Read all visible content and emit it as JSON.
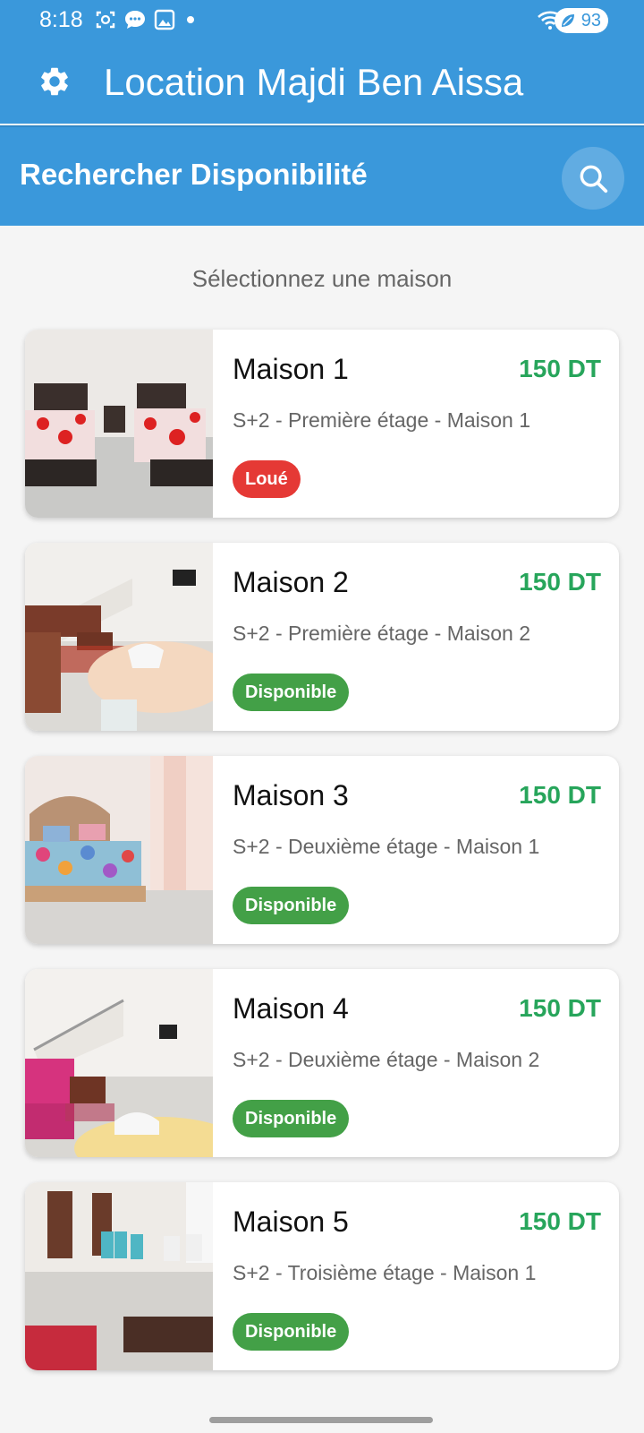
{
  "status_bar": {
    "time": "8:18",
    "battery": "93",
    "icons_left": [
      "screenshot-icon",
      "chat-icon",
      "image-icon",
      "dot-icon"
    ],
    "icons_right": [
      "wifi-icon",
      "signal-icon",
      "battery-icon"
    ]
  },
  "app_bar": {
    "title": "Location Majdi Ben Aissa",
    "settings_icon": "gear-icon"
  },
  "search_header": {
    "title": "Rechercher Disponibilité",
    "search_icon": "search-icon"
  },
  "select_label": "Sélectionnez une maison",
  "colors": {
    "primary": "#3a98db",
    "price": "#27a55b",
    "rented": "#e53935",
    "available": "#43a047"
  },
  "houses": [
    {
      "name": "Maison 1",
      "price": "150 DT",
      "description": "S+2 - Première étage - Maison 1",
      "status": "Loué"
    },
    {
      "name": "Maison 2",
      "price": "150 DT",
      "description": "S+2 - Première étage - Maison 2",
      "status": "Disponible"
    },
    {
      "name": "Maison 3",
      "price": "150 DT",
      "description": "S+2 - Deuxième étage - Maison 1",
      "status": "Disponible"
    },
    {
      "name": "Maison 4",
      "price": "150 DT",
      "description": "S+2 - Deuxième étage - Maison 2",
      "status": "Disponible"
    },
    {
      "name": "Maison 5",
      "price": "150 DT",
      "description": "S+2 - Troisième étage - Maison 1",
      "status": "Disponible"
    }
  ]
}
